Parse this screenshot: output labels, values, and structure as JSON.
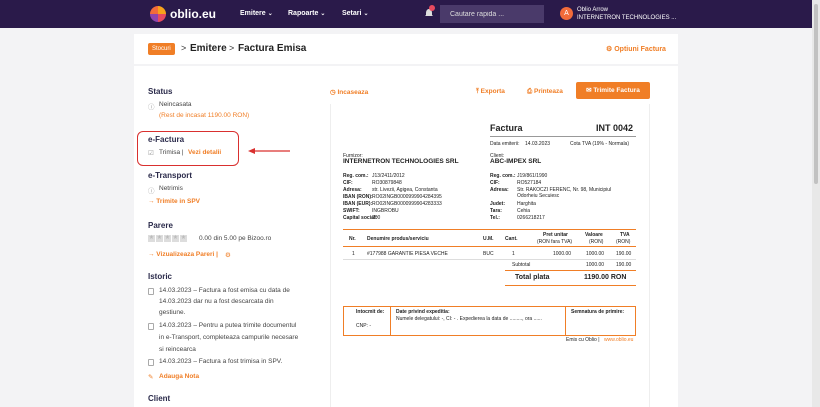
{
  "nav": {
    "logo": "oblio.eu",
    "emitere": "Emitere",
    "rapoarte": "Rapoarte",
    "setari": "Setari",
    "search_placeholder": "Cautare rapida ...",
    "user_initial": "A",
    "user_name": "Oblio Arrow",
    "user_company": "INTERNETRON TECHNOLOGIES ...",
    "chevron": "⌄"
  },
  "header": {
    "crumb_btn": "Stocuri",
    "crumb1": "Emitere",
    "crumb2": "Factura Emisa",
    "sep": ">",
    "optiuni": "⚙ Optiuni Factura"
  },
  "sidebar": {
    "status_title": "Status",
    "status_value": "Neincasata",
    "rest": "(Rest de incasat 1190.00 RON)",
    "efactura_title": "e-Factura",
    "efactura_value": "Trimisa |",
    "efactura_link": "Vezi detalii",
    "etransport_title": "e-Transport",
    "etransport_value": "Netrimis",
    "etransport_link": "→ Trimite in SPV",
    "parere_title": "Parere",
    "rating": "0.00 din 5.00 pe Bizoo.ro",
    "parere_link": "→ Vizualizeaza Pareri |",
    "istoric_title": "Istoric",
    "history": [
      {
        "l1": "14.03.2023 – Factura a fost emisa cu data de",
        "l2": "14.03.2023 dar nu a fost descarcata din",
        "l3": "gestiune."
      },
      {
        "l1": "14.03.2023 – Pentru a putea trimite documentul",
        "l2": "in e-Transport, completeaza campurile necesare",
        "l3": "si reincearca"
      },
      {
        "l1": "14.03.2023 – Factura a fost trimisa in SPV.",
        "l2": "",
        "l3": ""
      }
    ],
    "adauga": "Adauga Nota",
    "client_title": "Client"
  },
  "toolbar": {
    "incaseaza": "◷ Incaseaza",
    "exporta": "⤒ Exporta",
    "printeaza": "⎙ Printeaza",
    "trimite": "✉  Trimite Factura"
  },
  "invoice": {
    "title": "Factura",
    "number": "INT 0042",
    "date_label": "Data emiterii:",
    "date": "14.03.2023",
    "vat": "Cota TVA (19% - Normala)",
    "furnizor_label": "Furnizor:",
    "furnizor": "INTERNETRON TECHNOLOGIES SRL",
    "client_label": "Client:",
    "client": "ABC-IMPEX SRL",
    "f_fields": [
      [
        "Reg. com.:",
        "J13/2411/2012"
      ],
      [
        "CIF:",
        "RO30879848"
      ],
      [
        "Adresa:",
        "str. Livezii, Agigea, Constanta"
      ],
      [
        "IBAN (RON):",
        "RO02INGB0000999904284395"
      ],
      [
        "IBAN (EUR):",
        "RO02INGB0000999904283333"
      ],
      [
        "SWIFT:",
        "INGBROBU"
      ],
      [
        "Capital social:",
        "200"
      ]
    ],
    "c_fields": [
      [
        "Reg. com.:",
        "J19/861/1990"
      ],
      [
        "CIF:",
        "RO527184"
      ],
      [
        "Adresa:",
        "Str. RAKOCZI FERENC, Nr. 98, Municipiul"
      ],
      [
        "",
        "Odorheiu Secuiesc"
      ],
      [
        "Judet:",
        "Harghita"
      ],
      [
        "Tara:",
        "Cehia"
      ],
      [
        "Tel.:",
        "0266218217"
      ]
    ],
    "cols": {
      "nr": "Nr.",
      "denumire": "Denumire produs/serviciu",
      "um": "U.M.",
      "cant": "Cant.",
      "pret": "Pret unitar",
      "pret2": "(RON fara TVA)",
      "valoare": "Valoare",
      "valoare2": "(RON)",
      "tva": "TVA",
      "tva2": "(RON)"
    },
    "row": {
      "nr": "1",
      "denumire": "#177988 GARANTIE PIESA VECHE",
      "um": "BUC",
      "cant": "1",
      "pret": "1000.00",
      "valoare": "1000.00",
      "tva": "190.00"
    },
    "subtotal_label": "Subtotal",
    "subtotal_val": "1000.00",
    "subtotal_tva": "190.00",
    "total_label": "Total plata",
    "total": "1190.00 RON",
    "intocmit": "Intocmit de:",
    "date_exp": "Date privind expeditia:",
    "delegat": "Numele delegatului: -, CI: - . Expedierea la data de ........., ora ......",
    "cnp": "CNP: -",
    "semnatura": "Semnatura de primire:",
    "footer": "Emis cu Oblio |",
    "footer_link": "www.oblio.eu"
  }
}
